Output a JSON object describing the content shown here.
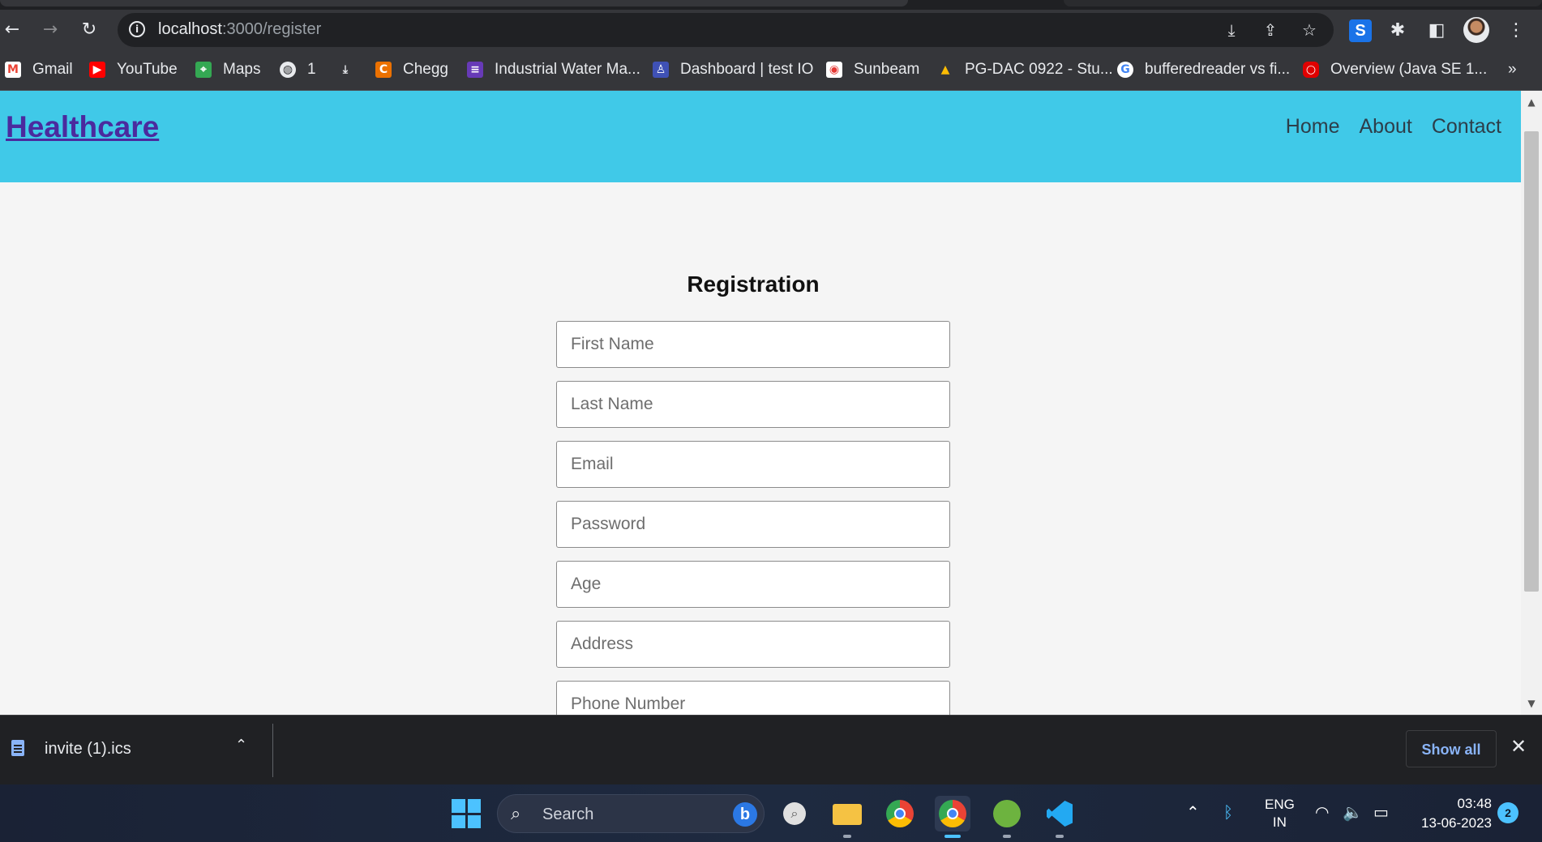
{
  "browser": {
    "url_host": "localhost",
    "url_path": ":3000/register",
    "bookmarks": [
      {
        "label": "Gmail",
        "icon": "gmail-icon",
        "color": "#ea4335"
      },
      {
        "label": "YouTube",
        "icon": "youtube-icon",
        "color": "#ff0000"
      },
      {
        "label": "Maps",
        "icon": "maps-icon",
        "color": "#34a853"
      },
      {
        "label": "1",
        "icon": "globe-icon",
        "color": "#e8eaed"
      },
      {
        "label": "",
        "icon": "download-icon",
        "color": "#e8eaed"
      },
      {
        "label": "Chegg",
        "icon": "chegg-icon",
        "color": "#eb7100"
      },
      {
        "label": "Industrial Water Ma...",
        "icon": "forms-icon",
        "color": "#673ab7"
      },
      {
        "label": "Dashboard | test IO",
        "icon": "testio-icon",
        "color": "#3f51b5"
      },
      {
        "label": "Sunbeam",
        "icon": "sunbeam-icon",
        "color": "#e53935"
      },
      {
        "label": "PG-DAC 0922 - Stu...",
        "icon": "drive-icon",
        "color": "#fbbc04"
      },
      {
        "label": "bufferedreader vs fi...",
        "icon": "google-icon",
        "color": "#4285f4"
      },
      {
        "label": "Overview (Java SE 1...",
        "icon": "oracle-icon",
        "color": "#e00000"
      }
    ],
    "more_bookmarks": "»"
  },
  "page": {
    "brand": "Healthcare",
    "nav": {
      "home": "Home",
      "about": "About",
      "contact": "Contact"
    },
    "title": "Registration",
    "fields": {
      "first_name": "First Name",
      "last_name": "Last Name",
      "email": "Email",
      "password": "Password",
      "age": "Age",
      "address": "Address",
      "phone": "Phone Number"
    }
  },
  "downloads": {
    "file_name": "invite (1).ics",
    "show_all": "Show all"
  },
  "taskbar": {
    "search_label": "Search",
    "lang_line1": "ENG",
    "lang_line2": "IN",
    "time": "03:48",
    "date": "13-06-2023",
    "notifications": "2"
  },
  "colors": {
    "navbar": "#40c9e8",
    "brand": "#4b2a9e",
    "accent": "#4cc2ff"
  }
}
